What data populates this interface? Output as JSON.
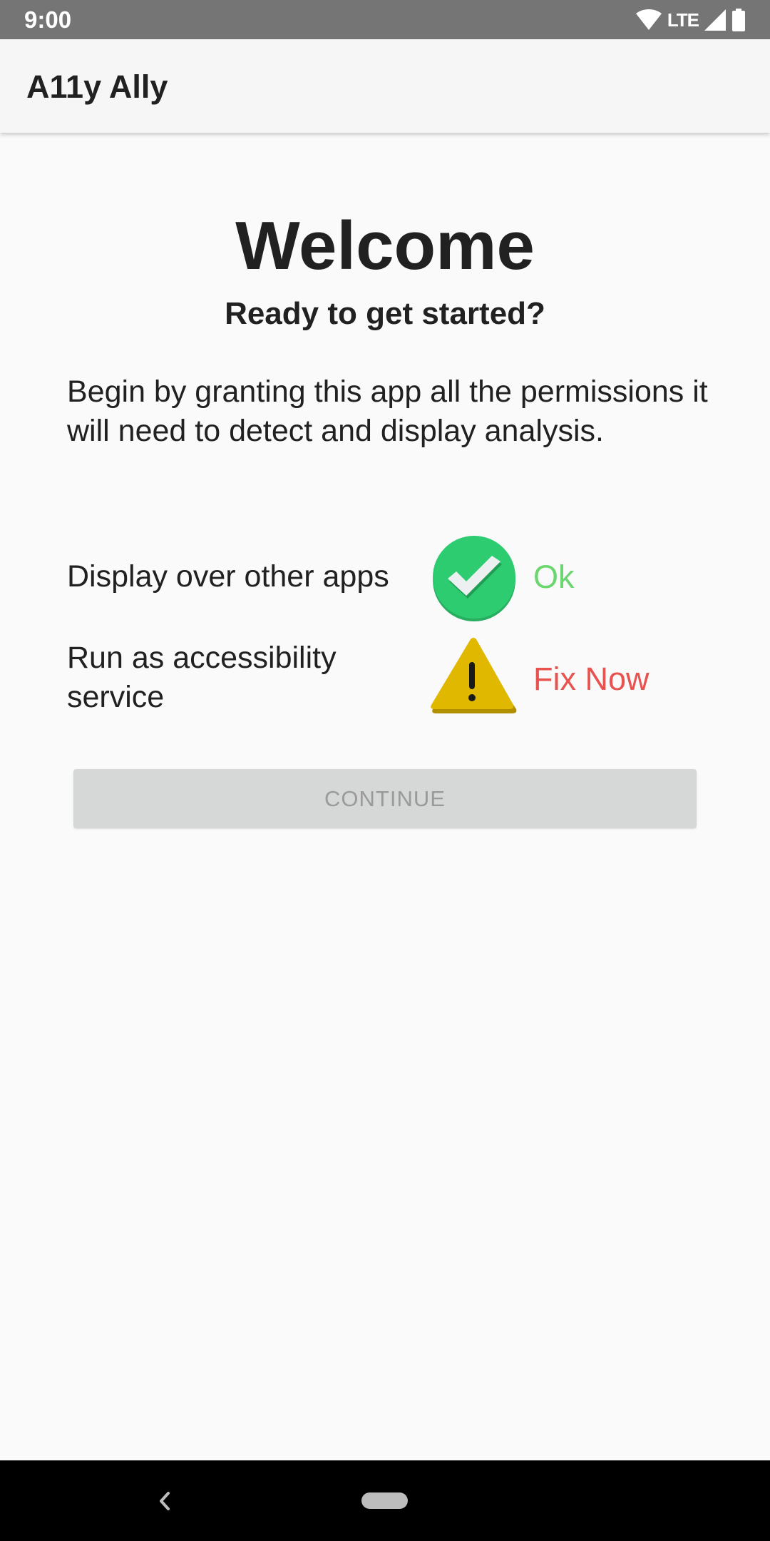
{
  "status_bar": {
    "time": "9:00",
    "network": "LTE",
    "icons": [
      "wifi-icon",
      "signal-icon",
      "battery-icon"
    ]
  },
  "app_bar": {
    "title": "A11y Ally"
  },
  "welcome": {
    "title": "Welcome",
    "subtitle": "Ready to get started?",
    "intro": "Begin by granting this app all the permissions it will need to detect and display analysis."
  },
  "permissions": [
    {
      "label": "Display over other apps",
      "icon": "check-circle-icon",
      "status": "Ok",
      "status_color": "#6bd66f"
    },
    {
      "label": "Run as accessibility service",
      "icon": "warning-icon",
      "status": "Fix Now",
      "status_color": "#e8524f"
    }
  ],
  "continue_button": {
    "label": "CONTINUE",
    "enabled": false
  },
  "colors": {
    "status_bar": "#757575",
    "check_green": "#2ecc71",
    "warning_yellow": "#e0b800",
    "ok_text": "#6bd66f",
    "fix_text": "#e8524f",
    "button_disabled": "#d6d7d7"
  },
  "nav_bar": {
    "icons": [
      "back-icon",
      "home-pill-icon"
    ]
  }
}
